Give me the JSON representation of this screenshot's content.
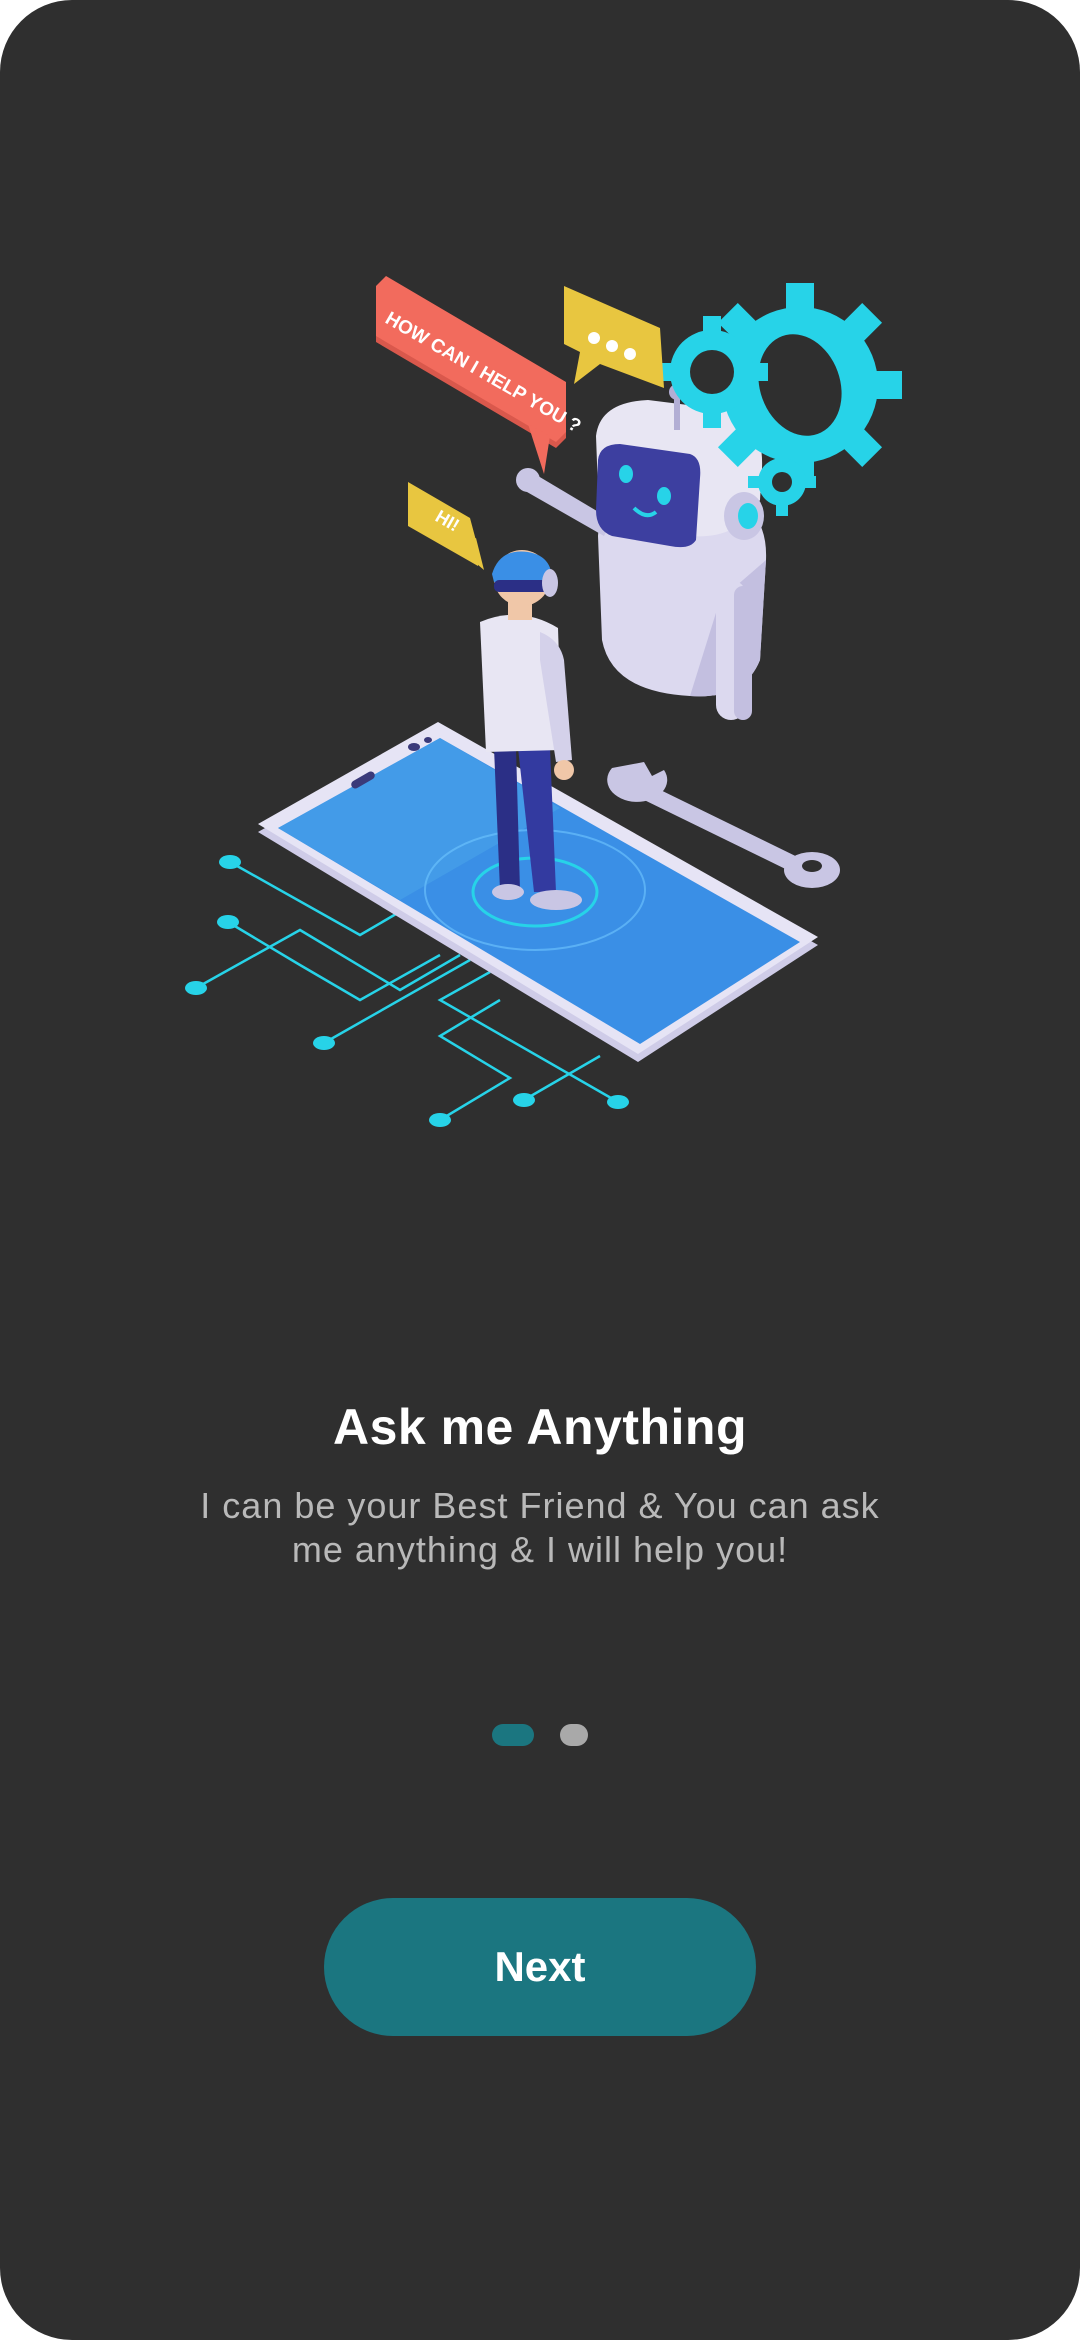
{
  "onboarding": {
    "title": "Ask me Anything",
    "subtitle": "I can be your Best Friend & You can ask me anything & I will help you!",
    "next_label": "Next",
    "page_indicator": {
      "current": 1,
      "total": 2
    }
  },
  "illustration": {
    "bubble_help": "HOW CAN I HELP YOU ?",
    "bubble_hi": "HI!",
    "bubble_dots": "•••"
  },
  "colors": {
    "background": "#2f2f2f",
    "accent": "#1b7680",
    "inactive_dot": "#a9a9a9",
    "title": "#ffffff",
    "subtitle": "#b9b9b9"
  }
}
